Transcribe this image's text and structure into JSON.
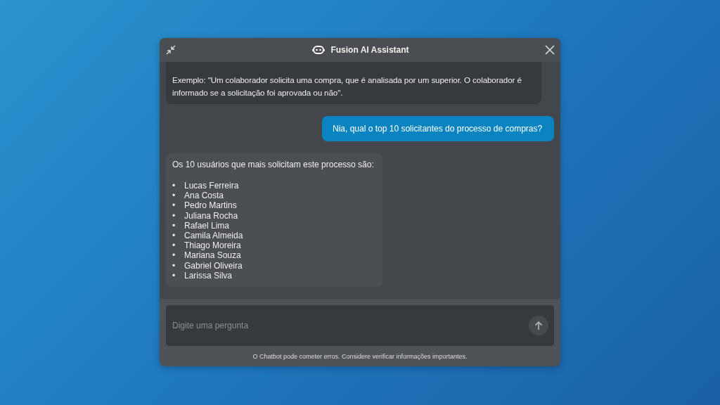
{
  "window": {
    "title": "Fusion AI Assistant"
  },
  "messages": [
    {
      "kind": "bot",
      "text": "Exemplo: \"Um colaborador solicita uma compra, que é analisada por um superior. O colaborador é informado se a solicitação foi aprovada ou não\"."
    },
    {
      "kind": "user",
      "text": "Nia, qual o top 10 solicitantes do processo de compras?"
    },
    {
      "kind": "bot",
      "text": "Os 10 usuários que mais solicitam este processo são:",
      "items": [
        "Lucas Ferreira",
        "Ana Costa",
        "Pedro Martins",
        "Juliana Rocha",
        "Rafael Lima",
        "Camila Almeida",
        "Thiago Moreira",
        "Mariana Souza",
        "Gabriel Oliveira",
        "Larissa Silva"
      ]
    }
  ],
  "input": {
    "placeholder": "Digite uma pergunta"
  },
  "bullet": "•",
  "disclaimer": "O Chatbot pode cometer erros. Considere verificar informações importantes."
}
